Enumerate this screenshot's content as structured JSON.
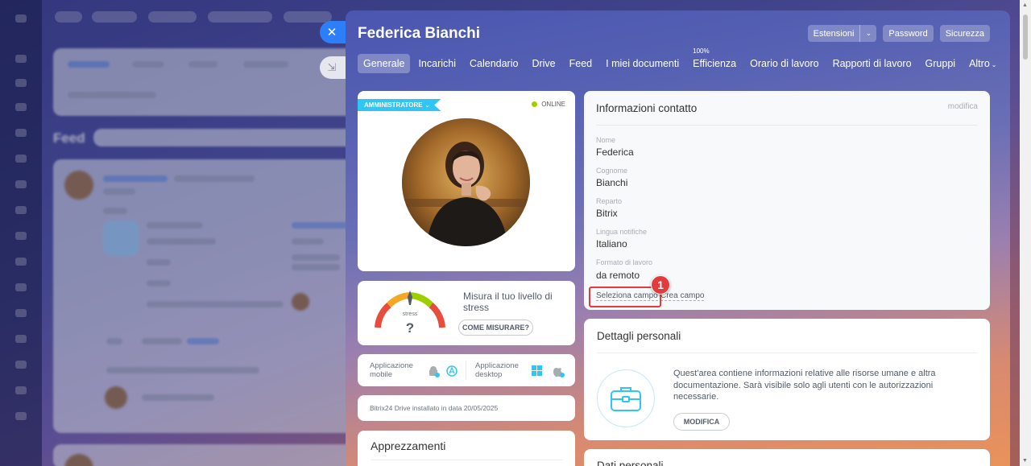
{
  "panel": {
    "title": "Federica Bianchi",
    "actions": {
      "extensions_label": "Estensioni",
      "password_label": "Password",
      "security_label": "Sicurezza"
    },
    "tabs": [
      {
        "label": "Generale"
      },
      {
        "label": "Incarichi"
      },
      {
        "label": "Calendario"
      },
      {
        "label": "Drive"
      },
      {
        "label": "Feed"
      },
      {
        "label": "I miei documenti"
      },
      {
        "label": "Efficienza",
        "sup": "100%"
      },
      {
        "label": "Orario di lavoro"
      },
      {
        "label": "Rapporti di lavoro"
      },
      {
        "label": "Gruppi"
      },
      {
        "label": "Altro"
      }
    ]
  },
  "profile": {
    "role_badge": "AMMINISTRATORE",
    "status": "ONLINE",
    "status_color": "#9dcf00"
  },
  "stress": {
    "gauge_label": "stress",
    "gauge_value": "?",
    "text": "Misura il tuo livello di stress",
    "button": "COME MISURARE?"
  },
  "apps": {
    "mobile_label_1": "Applicazione",
    "mobile_label_2": "mobile",
    "desktop_label_1": "Applicazione",
    "desktop_label_2": "desktop"
  },
  "drive": {
    "text": "Bitrix24 Drive installato in data 20/05/2025"
  },
  "appreciations": {
    "title": "Apprezzamenti"
  },
  "contact": {
    "title": "Informazioni contatto",
    "edit": "modifica",
    "fields": [
      {
        "label": "Nome",
        "value": "Federica"
      },
      {
        "label": "Cognome",
        "value": "Bianchi"
      },
      {
        "label": "Reparto",
        "value": "Bitrix"
      },
      {
        "label": "Lingua notifiche",
        "value": "Italiano"
      },
      {
        "label": "Formato di lavoro",
        "value": "da remoto"
      }
    ],
    "select_field": "Seleziona campo",
    "create_field": "Crea campo",
    "marker": "1"
  },
  "personal_details": {
    "title": "Dettagli personali",
    "text": "Quest'area contiene informazioni relative alle risorse umane e altra documentazione. Sarà visibile solo agli utenti con le autorizzazioni necessarie.",
    "button": "MODIFICA"
  },
  "personal_data": {
    "title": "Dati personali"
  },
  "background_app": {
    "feed_title": "Feed"
  },
  "colors": {
    "accent": "#2fc6f6",
    "close_button": "#2d7ff9",
    "highlight": "#e33b3b"
  }
}
